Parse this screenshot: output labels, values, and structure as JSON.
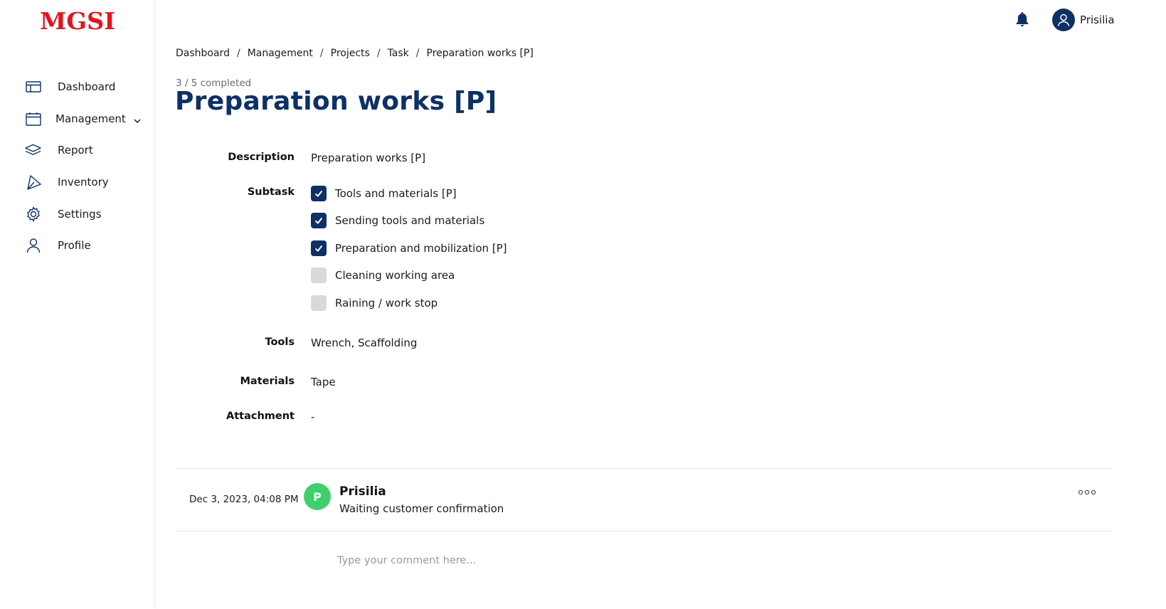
{
  "brand": {
    "logo_text": "MGSI",
    "logo_color": "#e0161e"
  },
  "colors": {
    "primary": "#0d3067",
    "avatar_comment": "#3fcf6b",
    "checkbox_off": "#d9d9d9"
  },
  "sidebar": {
    "items": [
      {
        "label": "Dashboard",
        "icon": "dashboard-icon"
      },
      {
        "label": "Management",
        "icon": "calendar-icon",
        "has_submenu": true
      },
      {
        "label": "Report",
        "icon": "layers-icon"
      },
      {
        "label": "Inventory",
        "icon": "send-icon"
      },
      {
        "label": "Settings",
        "icon": "gear-icon"
      },
      {
        "label": "Profile",
        "icon": "user-icon"
      }
    ]
  },
  "topbar": {
    "user_name": "Prisilia",
    "notification_icon": "bell-icon",
    "avatar_icon": "user-circle-icon"
  },
  "breadcrumb": [
    "Dashboard",
    "Management",
    "Projects",
    "Task",
    "Preparation works [P]"
  ],
  "task": {
    "progress_text": "3 / 5 completed",
    "title": "Preparation works [P]",
    "labels": {
      "description": "Description",
      "subtask": "Subtask",
      "tools": "Tools",
      "materials": "Materials",
      "attachment": "Attachment"
    },
    "description": "Preparation works [P]",
    "subtasks": [
      {
        "label": "Tools and materials [P]",
        "checked": true
      },
      {
        "label": "Sending tools and materials",
        "checked": true
      },
      {
        "label": "Preparation and mobilization [P]",
        "checked": true
      },
      {
        "label": "Cleaning working area",
        "checked": false
      },
      {
        "label": "Raining / work stop",
        "checked": false
      }
    ],
    "tools": "Wrench, Scaffolding",
    "materials": "Tape",
    "attachment": "-"
  },
  "comments": [
    {
      "date": "Dec 3, 2023, 04:08 PM",
      "avatar_letter": "P",
      "author": "Prisilia",
      "text": "Waiting customer confirmation"
    }
  ],
  "comment_input": {
    "placeholder": "Type your comment here..."
  }
}
